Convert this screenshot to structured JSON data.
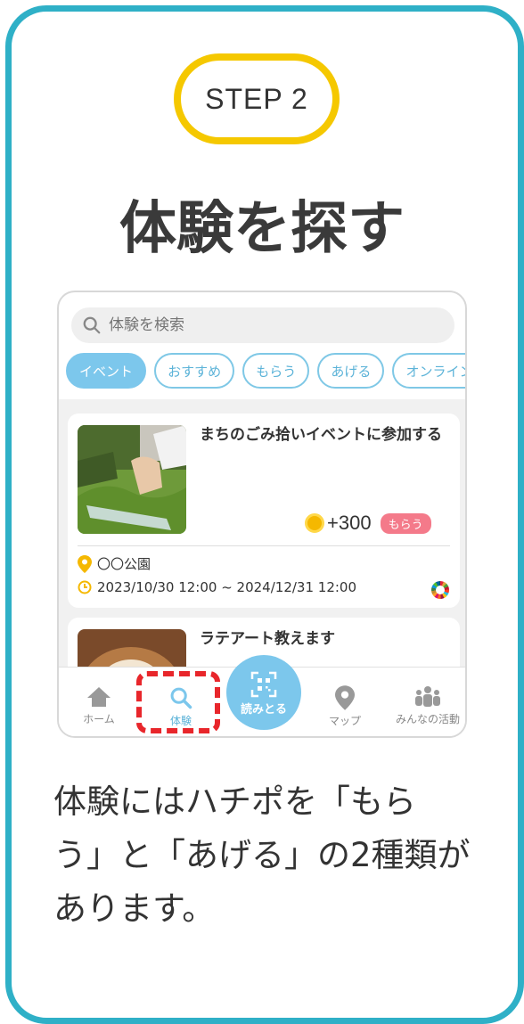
{
  "step": "STEP 2",
  "title": "体験を探す",
  "search": {
    "placeholder": "体験を検索"
  },
  "chips": [
    "イベント",
    "おすすめ",
    "もらう",
    "あげる",
    "オンライン"
  ],
  "events": [
    {
      "title": "まちのごみ拾いイベントに参加する",
      "points": "+300",
      "badge": "もらう",
      "location": "〇〇公園",
      "datetime": "2023/10/30 12:00 ~ 2024/12/31 12:00"
    },
    {
      "title": "ラテアート教えます"
    }
  ],
  "nav": {
    "home": "ホーム",
    "experience": "体験",
    "scan": "読みとる",
    "map": "マップ",
    "activity": "みんなの活動"
  },
  "description": [
    "体験にはハチポを「もら",
    "う」と「あげる」の2種類が",
    "あります。"
  ],
  "colors": {
    "frame": "#2fb0c7",
    "step_border": "#f5c800",
    "accent": "#7cc7ec",
    "highlight": "#e8262b",
    "badge": "#f47a8a"
  }
}
